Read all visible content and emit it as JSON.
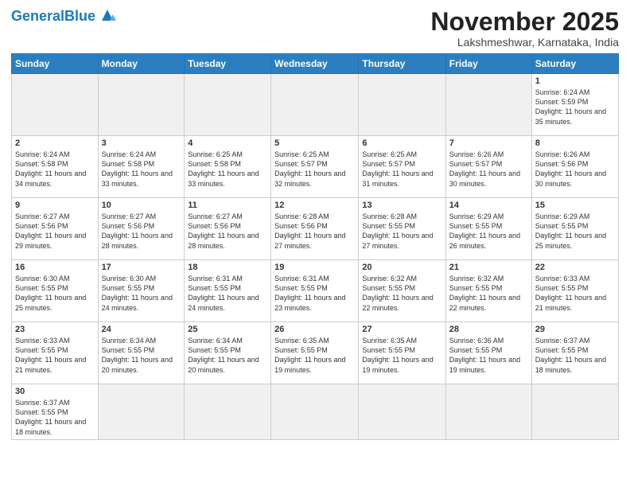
{
  "header": {
    "logo_general": "General",
    "logo_blue": "Blue",
    "month_title": "November 2025",
    "location": "Lakshmeshwar, Karnataka, India"
  },
  "weekdays": [
    "Sunday",
    "Monday",
    "Tuesday",
    "Wednesday",
    "Thursday",
    "Friday",
    "Saturday"
  ],
  "weeks": [
    [
      {
        "day": "",
        "info": ""
      },
      {
        "day": "",
        "info": ""
      },
      {
        "day": "",
        "info": ""
      },
      {
        "day": "",
        "info": ""
      },
      {
        "day": "",
        "info": ""
      },
      {
        "day": "",
        "info": ""
      },
      {
        "day": "1",
        "info": "Sunrise: 6:24 AM\nSunset: 5:59 PM\nDaylight: 11 hours and 35 minutes."
      }
    ],
    [
      {
        "day": "2",
        "info": "Sunrise: 6:24 AM\nSunset: 5:58 PM\nDaylight: 11 hours and 34 minutes."
      },
      {
        "day": "3",
        "info": "Sunrise: 6:24 AM\nSunset: 5:58 PM\nDaylight: 11 hours and 33 minutes."
      },
      {
        "day": "4",
        "info": "Sunrise: 6:25 AM\nSunset: 5:58 PM\nDaylight: 11 hours and 33 minutes."
      },
      {
        "day": "5",
        "info": "Sunrise: 6:25 AM\nSunset: 5:57 PM\nDaylight: 11 hours and 32 minutes."
      },
      {
        "day": "6",
        "info": "Sunrise: 6:25 AM\nSunset: 5:57 PM\nDaylight: 11 hours and 31 minutes."
      },
      {
        "day": "7",
        "info": "Sunrise: 6:26 AM\nSunset: 5:57 PM\nDaylight: 11 hours and 30 minutes."
      },
      {
        "day": "8",
        "info": "Sunrise: 6:26 AM\nSunset: 5:56 PM\nDaylight: 11 hours and 30 minutes."
      }
    ],
    [
      {
        "day": "9",
        "info": "Sunrise: 6:27 AM\nSunset: 5:56 PM\nDaylight: 11 hours and 29 minutes."
      },
      {
        "day": "10",
        "info": "Sunrise: 6:27 AM\nSunset: 5:56 PM\nDaylight: 11 hours and 28 minutes."
      },
      {
        "day": "11",
        "info": "Sunrise: 6:27 AM\nSunset: 5:56 PM\nDaylight: 11 hours and 28 minutes."
      },
      {
        "day": "12",
        "info": "Sunrise: 6:28 AM\nSunset: 5:56 PM\nDaylight: 11 hours and 27 minutes."
      },
      {
        "day": "13",
        "info": "Sunrise: 6:28 AM\nSunset: 5:55 PM\nDaylight: 11 hours and 27 minutes."
      },
      {
        "day": "14",
        "info": "Sunrise: 6:29 AM\nSunset: 5:55 PM\nDaylight: 11 hours and 26 minutes."
      },
      {
        "day": "15",
        "info": "Sunrise: 6:29 AM\nSunset: 5:55 PM\nDaylight: 11 hours and 25 minutes."
      }
    ],
    [
      {
        "day": "16",
        "info": "Sunrise: 6:30 AM\nSunset: 5:55 PM\nDaylight: 11 hours and 25 minutes."
      },
      {
        "day": "17",
        "info": "Sunrise: 6:30 AM\nSunset: 5:55 PM\nDaylight: 11 hours and 24 minutes."
      },
      {
        "day": "18",
        "info": "Sunrise: 6:31 AM\nSunset: 5:55 PM\nDaylight: 11 hours and 24 minutes."
      },
      {
        "day": "19",
        "info": "Sunrise: 6:31 AM\nSunset: 5:55 PM\nDaylight: 11 hours and 23 minutes."
      },
      {
        "day": "20",
        "info": "Sunrise: 6:32 AM\nSunset: 5:55 PM\nDaylight: 11 hours and 22 minutes."
      },
      {
        "day": "21",
        "info": "Sunrise: 6:32 AM\nSunset: 5:55 PM\nDaylight: 11 hours and 22 minutes."
      },
      {
        "day": "22",
        "info": "Sunrise: 6:33 AM\nSunset: 5:55 PM\nDaylight: 11 hours and 21 minutes."
      }
    ],
    [
      {
        "day": "23",
        "info": "Sunrise: 6:33 AM\nSunset: 5:55 PM\nDaylight: 11 hours and 21 minutes."
      },
      {
        "day": "24",
        "info": "Sunrise: 6:34 AM\nSunset: 5:55 PM\nDaylight: 11 hours and 20 minutes."
      },
      {
        "day": "25",
        "info": "Sunrise: 6:34 AM\nSunset: 5:55 PM\nDaylight: 11 hours and 20 minutes."
      },
      {
        "day": "26",
        "info": "Sunrise: 6:35 AM\nSunset: 5:55 PM\nDaylight: 11 hours and 19 minutes."
      },
      {
        "day": "27",
        "info": "Sunrise: 6:35 AM\nSunset: 5:55 PM\nDaylight: 11 hours and 19 minutes."
      },
      {
        "day": "28",
        "info": "Sunrise: 6:36 AM\nSunset: 5:55 PM\nDaylight: 11 hours and 19 minutes."
      },
      {
        "day": "29",
        "info": "Sunrise: 6:37 AM\nSunset: 5:55 PM\nDaylight: 11 hours and 18 minutes."
      }
    ],
    [
      {
        "day": "30",
        "info": "Sunrise: 6:37 AM\nSunset: 5:55 PM\nDaylight: 11 hours and 18 minutes."
      },
      {
        "day": "",
        "info": ""
      },
      {
        "day": "",
        "info": ""
      },
      {
        "day": "",
        "info": ""
      },
      {
        "day": "",
        "info": ""
      },
      {
        "day": "",
        "info": ""
      },
      {
        "day": "",
        "info": ""
      }
    ]
  ]
}
